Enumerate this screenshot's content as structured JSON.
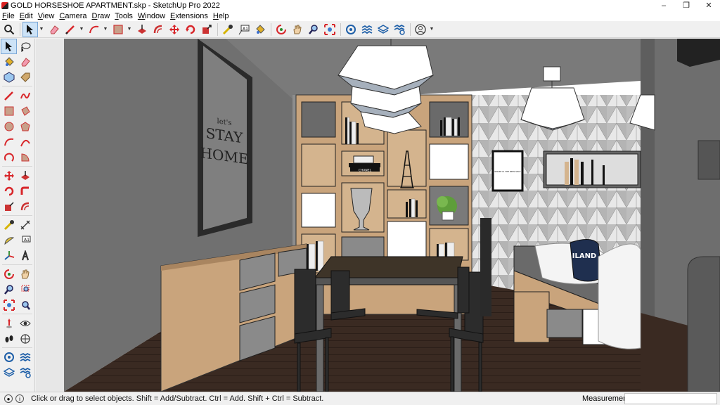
{
  "window": {
    "title": "GOLD HORSESHOE APARTMENT.skp - SketchUp Pro 2022",
    "controls": {
      "minimize": "–",
      "maximize": "❐",
      "close": "✕"
    }
  },
  "menu": [
    "File",
    "Edit",
    "View",
    "Camera",
    "Draw",
    "Tools",
    "Window",
    "Extensions",
    "Help"
  ],
  "poster": {
    "line1": "let's",
    "line2": "STAY",
    "line3": "HOME"
  },
  "frame_small": {
    "text": "SMART IS THE NEW SEXY"
  },
  "pillow_text": "ILAND",
  "book_label": "CHANEL",
  "status": {
    "message": "Click or drag to select objects. Shift = Add/Subtract. Ctrl = Add. Shift + Ctrl = Subtract.",
    "measurements_label": "Measurements",
    "measurements_value": ""
  },
  "colors": {
    "accent_red": "#d8262a",
    "wall_gray": "#6d6d6d",
    "floor": "#3b2b23",
    "wood": "#c9a47c"
  }
}
